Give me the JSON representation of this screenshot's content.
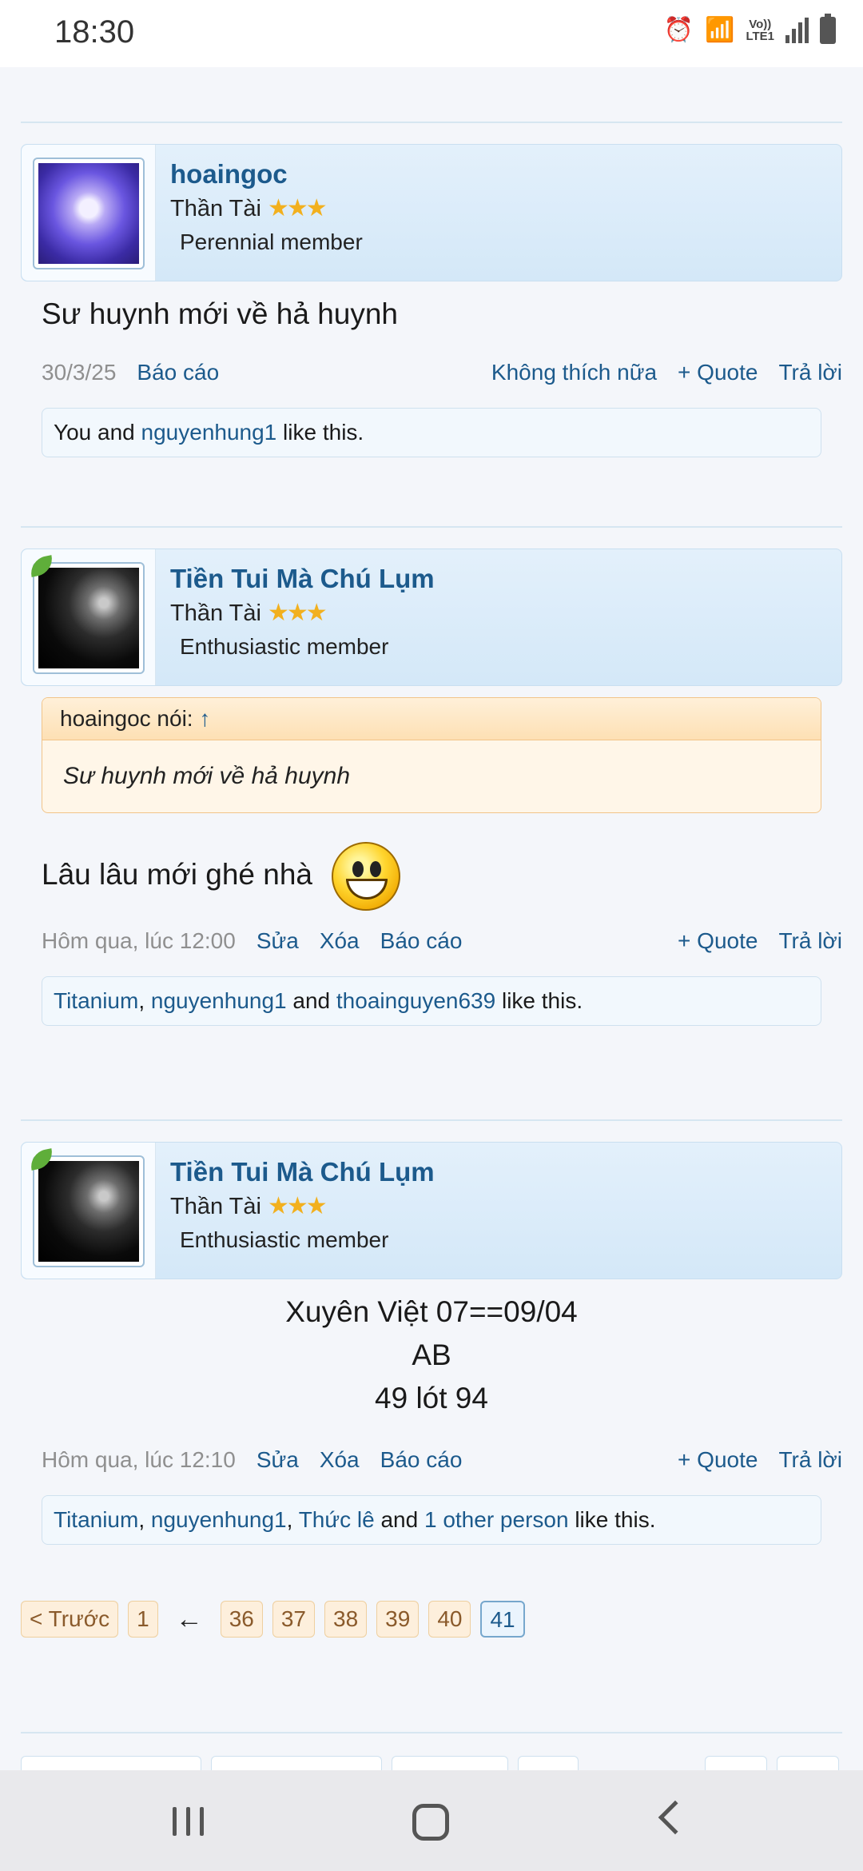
{
  "status_bar": {
    "time": "18:30",
    "icons": [
      "alarm-icon",
      "wifi-icon",
      "volte-icon",
      "signal-icon",
      "battery-icon"
    ],
    "volte_label": "Vo))\nLTE1"
  },
  "posts": [
    {
      "username": "hoaingoc",
      "title": "Thần Tài",
      "stars": "★★★",
      "rank": "Perennial member",
      "message": "Sư huynh mới về hả huynh",
      "date": "30/3/25",
      "left_actions": [
        "Báo cáo"
      ],
      "right_actions": [
        "Không thích nữa",
        "+ Quote",
        "Trả lời"
      ],
      "likes": {
        "prefix": "You and ",
        "links": [
          "nguyenhung1"
        ],
        "suffix": " like this."
      }
    },
    {
      "username": "Tiền Tui Mà Chú Lụm",
      "title": "Thần Tài",
      "stars": "★★★",
      "rank": "Enthusiastic member",
      "quote": {
        "author": "hoaingoc nói:",
        "arrow": "↑",
        "text": "Sư huynh mới về hả huynh"
      },
      "message": "Lâu lâu mới ghé nhà",
      "date": "Hôm qua, lúc 12:00",
      "left_actions": [
        "Sửa",
        "Xóa",
        "Báo cáo"
      ],
      "right_actions": [
        "+ Quote",
        "Trả lời"
      ],
      "likes": {
        "links": [
          "Titanium",
          "nguyenhung1",
          "thoainguyen639"
        ],
        "sep1": ", ",
        "sep2": " and ",
        "suffix": " like this."
      }
    },
    {
      "username": "Tiền Tui Mà Chú Lụm",
      "title": "Thần Tài",
      "stars": "★★★",
      "rank": "Enthusiastic member",
      "message_lines": [
        "Xuyên Việt 07==09/04",
        "AB",
        "49 lót 94"
      ],
      "date": "Hôm qua, lúc 12:10",
      "left_actions": [
        "Sửa",
        "Xóa",
        "Báo cáo"
      ],
      "right_actions": [
        "+ Quote",
        "Trả lời"
      ],
      "likes": {
        "links": [
          "Titanium",
          "nguyenhung1",
          "Thức lê",
          "1 other person"
        ],
        "sep1": ", ",
        "sep2": ", ",
        "sep3": " and ",
        "suffix": " like this."
      }
    }
  ],
  "pagination": {
    "prev": "< Trước",
    "first": "1",
    "gap": "←",
    "pages": [
      "36",
      "37",
      "38",
      "39",
      "40"
    ],
    "current": "41"
  }
}
